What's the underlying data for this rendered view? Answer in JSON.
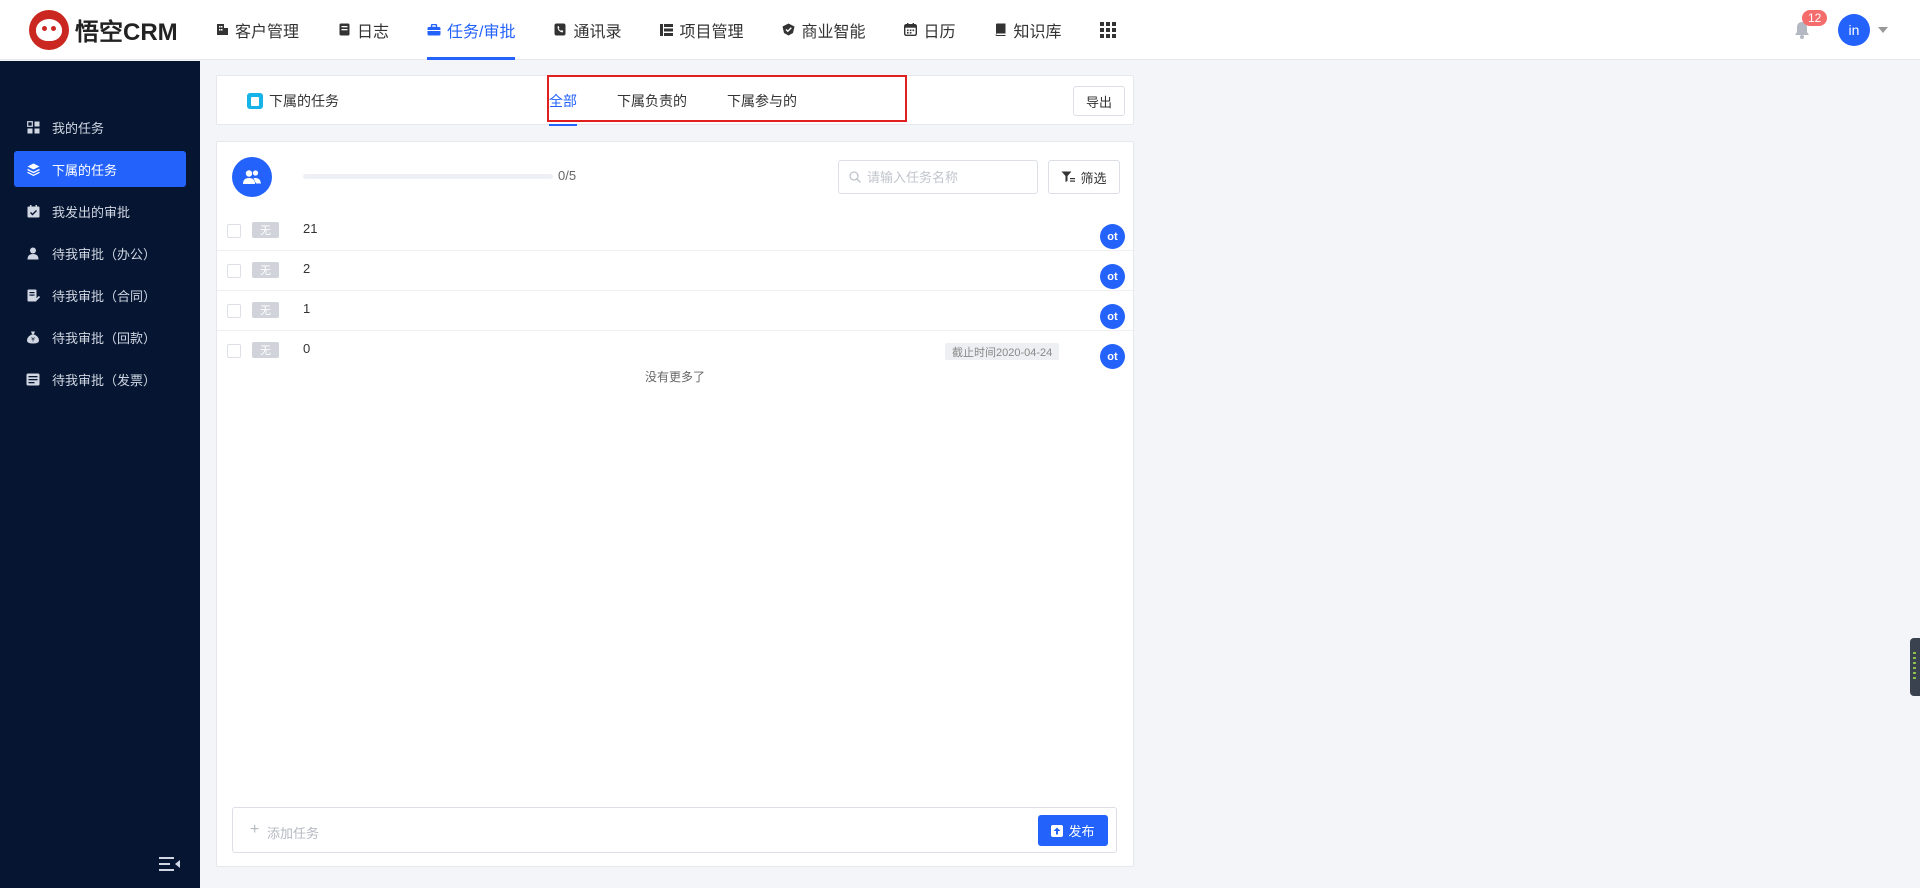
{
  "app": {
    "logo_text": "悟空CRM",
    "notification_count": "12",
    "user_initials": "in",
    "accent_color": "#2362fb",
    "sidebar_color": "#061632"
  },
  "nav": {
    "items": [
      {
        "label": "客户管理",
        "icon": "building-icon",
        "active": false
      },
      {
        "label": "日志",
        "icon": "notebook-icon",
        "active": false
      },
      {
        "label": "任务/审批",
        "icon": "briefcase-icon",
        "active": true
      },
      {
        "label": "通讯录",
        "icon": "phone-book-icon",
        "active": false
      },
      {
        "label": "项目管理",
        "icon": "project-icon",
        "active": false
      },
      {
        "label": "商业智能",
        "icon": "shield-icon",
        "active": false
      },
      {
        "label": "日历",
        "icon": "calendar-icon",
        "active": false
      },
      {
        "label": "知识库",
        "icon": "book-icon",
        "active": false
      }
    ]
  },
  "sidebar": {
    "items": [
      {
        "label": "我的任务",
        "icon": "dashboard-icon",
        "active": false
      },
      {
        "label": "下属的任务",
        "icon": "layers-icon",
        "active": true
      },
      {
        "label": "我发出的审批",
        "icon": "calendar-check-icon",
        "active": false
      },
      {
        "label": "待我审批（办公）",
        "icon": "user-icon",
        "active": false
      },
      {
        "label": "待我审批（合同）",
        "icon": "contract-icon",
        "active": false
      },
      {
        "label": "待我审批（回款）",
        "icon": "money-bag-icon",
        "active": false
      },
      {
        "label": "待我审批（发票）",
        "icon": "invoice-icon",
        "active": false
      }
    ]
  },
  "header": {
    "title": "下属的任务",
    "tabs": [
      {
        "label": "全部",
        "active": true
      },
      {
        "label": "下属负责的",
        "active": false
      },
      {
        "label": "下属参与的",
        "active": false
      }
    ],
    "export_label": "导出"
  },
  "main": {
    "progress": {
      "done": 0,
      "total": 5,
      "text": "0/5"
    },
    "search_placeholder": "请输入任务名称",
    "filter_label": "筛选",
    "tasks": [
      {
        "priority": "无",
        "name": "21",
        "deadline": "",
        "owner": "ot"
      },
      {
        "priority": "无",
        "name": "2",
        "deadline": "",
        "owner": "ot"
      },
      {
        "priority": "无",
        "name": "1",
        "deadline": "",
        "owner": "ot"
      },
      {
        "priority": "无",
        "name": "0",
        "deadline": "截止时间2020-04-24",
        "owner": "ot"
      }
    ],
    "no_more_text": "没有更多了",
    "add_task_placeholder": "添加任务",
    "publish_label": "发布"
  }
}
